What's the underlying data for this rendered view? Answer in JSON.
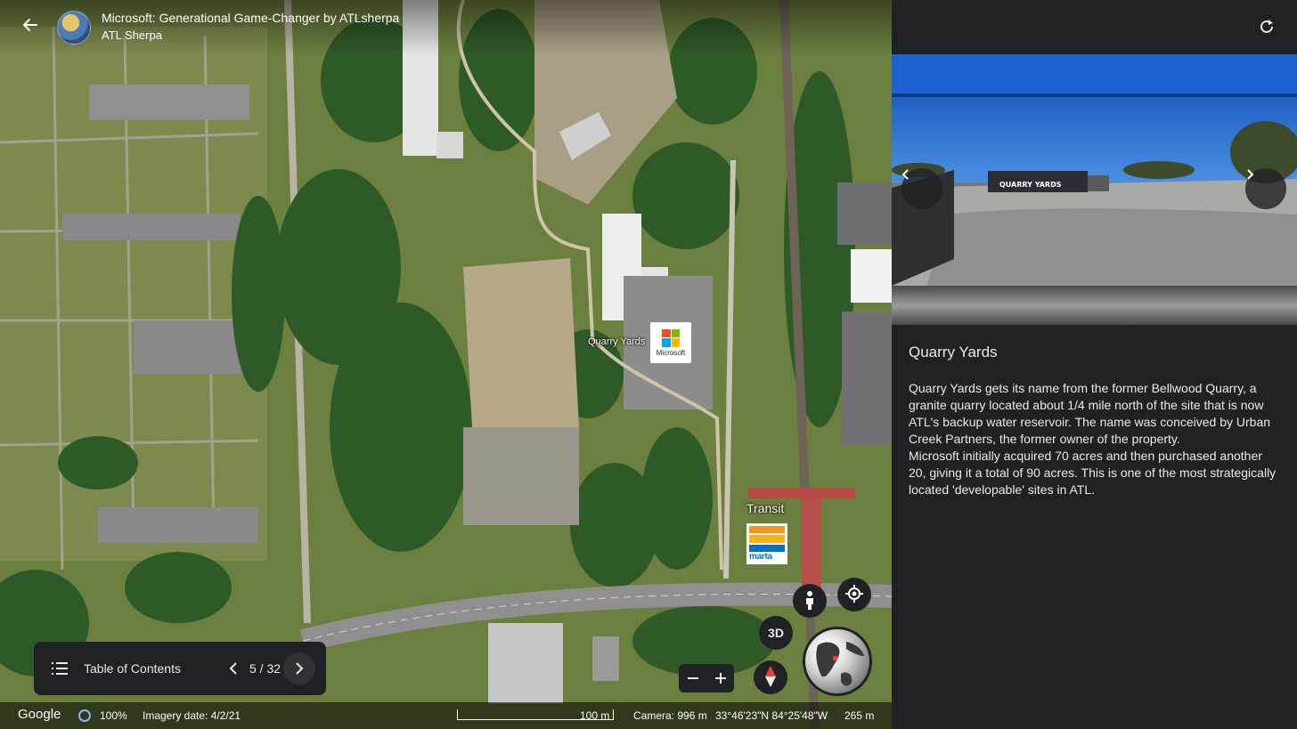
{
  "header": {
    "title": "Microsoft: Generational Game-Changer by ATLsherpa",
    "author": "ATL Sherpa",
    "back_icon": "arrow-left-icon",
    "avatar_icon": "author-avatar"
  },
  "map": {
    "place_label": "Quarry Yards",
    "microsoft_caption": "Microsoft",
    "microsoft_colors": [
      "#f25022",
      "#7fba00",
      "#00a4ef",
      "#ffb900"
    ],
    "transit_label": "Transit",
    "marta_text": "marta",
    "marta_colors": [
      "#f7941d",
      "#fbb117",
      "#0072bc"
    ],
    "buttons": {
      "pegman_icon": "pegman-icon",
      "locate_icon": "my-location-icon",
      "three_d_label": "3D",
      "compass_icon": "compass-icon",
      "zoom_out_icon": "minus-icon",
      "zoom_in_icon": "plus-icon"
    }
  },
  "toc": {
    "label": "Table of Contents",
    "counter": "5 / 32",
    "list_icon": "list-icon",
    "prev_icon": "chevron-left-icon",
    "next_icon": "chevron-right-icon"
  },
  "status": {
    "brand": "Google",
    "load_percent": "100%",
    "imagery_date": "Imagery date: 4/2/21",
    "scale": "100 m",
    "camera": "Camera: 996 m",
    "coordinates": "33°46'23\"N 84°25'48\"W",
    "elevation": "265 m"
  },
  "panel": {
    "refresh_icon": "refresh-icon",
    "photo_sign": "QUARRY YARDS",
    "title": "Quarry Yards",
    "paragraphs": [
      "Quarry Yards gets its name from the former Bellwood Quarry, a granite quarry located about 1/4 mile north of the site that is now ATL's backup water reservoir. The name was conceived by Urban Creek Partners, the former owner of the property.",
      "Microsoft initially acquired 70 acres and then purchased another 20, giving it a total of 90 acres. This is one of the most strategically located 'developable' sites in ATL."
    ]
  },
  "colors": {
    "panel_bg": "#202124",
    "text": "#e8eaed",
    "accent_blue": "#8ab4f8"
  }
}
